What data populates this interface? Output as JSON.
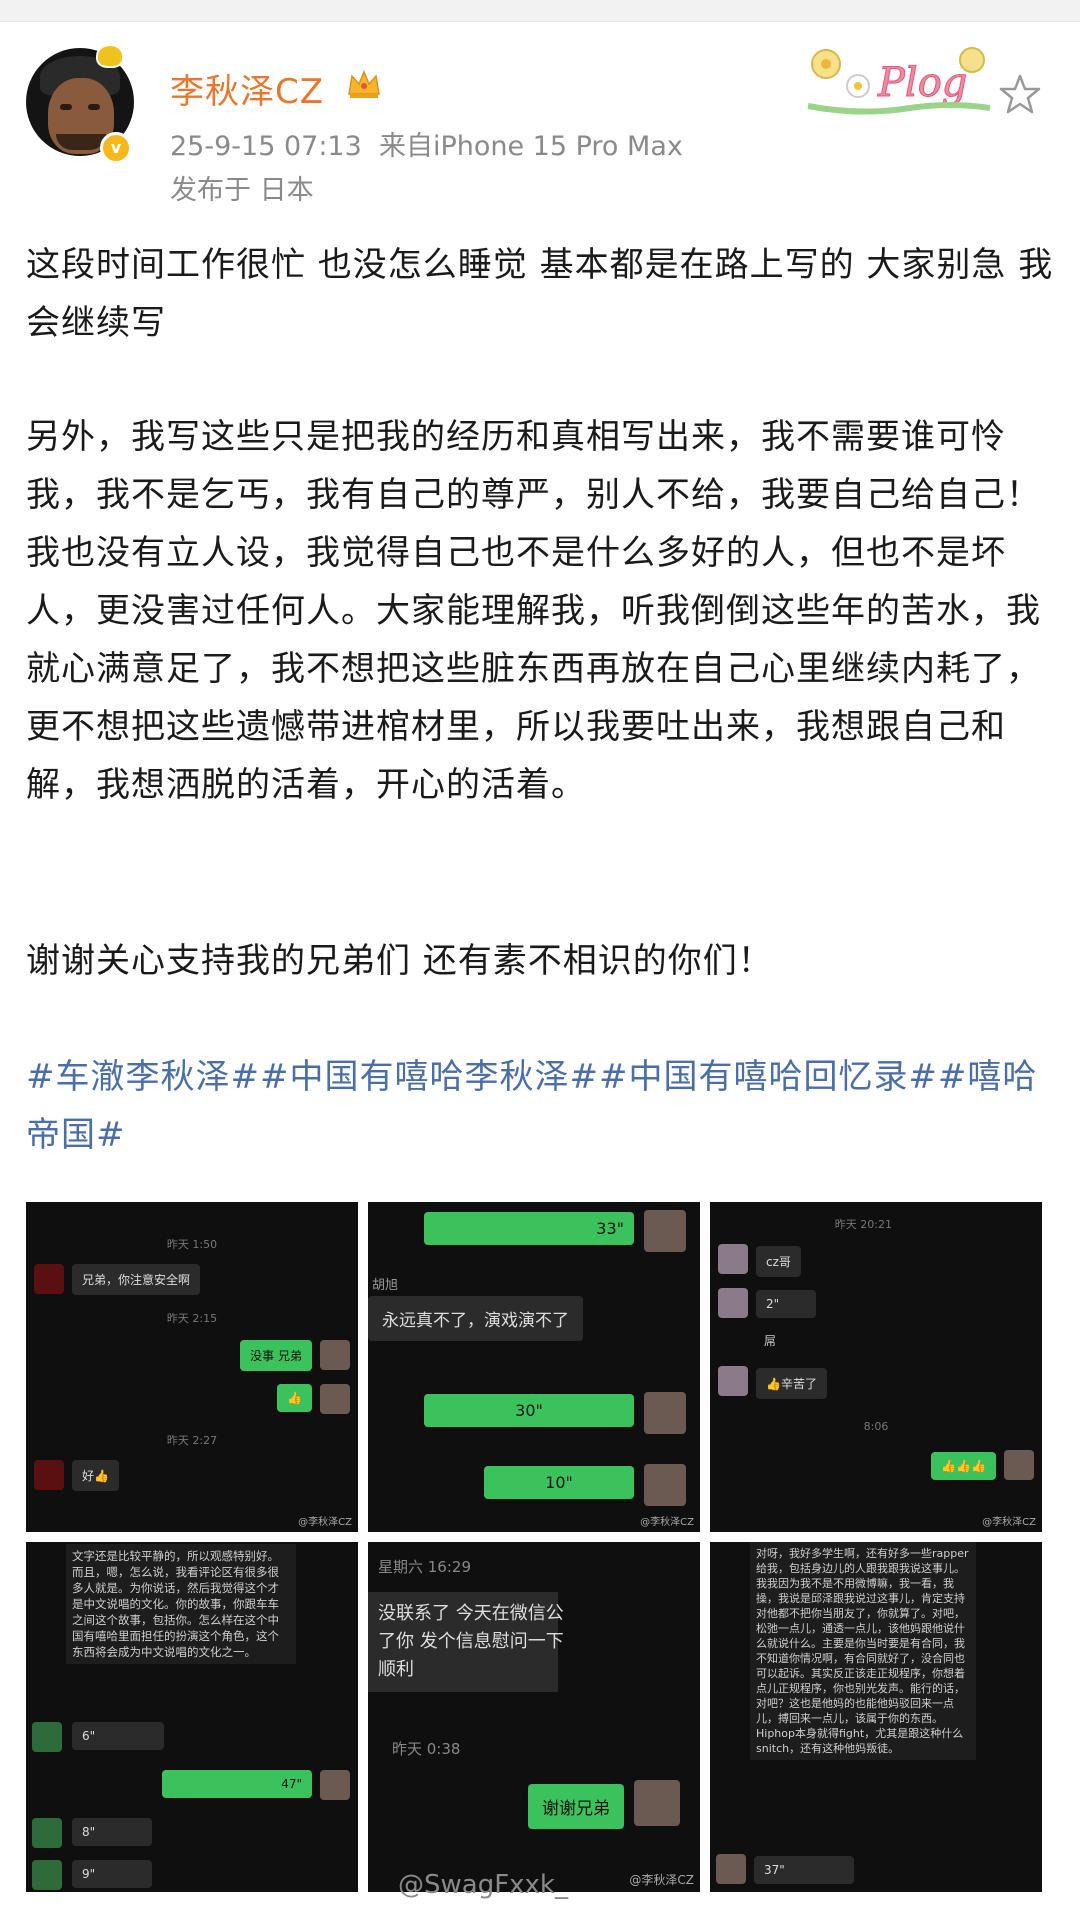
{
  "header": {
    "username": "李秋泽CZ",
    "timestamp": "25-9-15 07:13",
    "source": "来自iPhone 15 Pro Max",
    "location": "发布于 日本",
    "badge_icon": "verified-badge-icon",
    "sticker_text": "Plog"
  },
  "post": {
    "para1": "这段时间工作很忙 也没怎么睡觉 基本都是在路上写的 大家别急 我会继续写",
    "para2": "另外，我写这些只是把我的经历和真相写出来，我不需要谁可怜我，我不是乞丐，我有自己的尊严，别人不给，我要自己给自己！我也没有立人设，我觉得自己也不是什么多好的人，但也不是坏人，更没害过任何人。大家能理解我，听我倒倒这些年的苦水，我就心满意足了，我不想把这些脏东西再放在自己心里继续内耗了，更不想把这些遗憾带进棺材里，所以我要吐出来，我想跟自己和解，我想洒脱的活着，开心的活着。",
    "para3": "谢谢关心支持我的兄弟们 还有素不相识的你们！",
    "tags": "#车澈李秋泽##中国有嘻哈李秋泽##中国有嘻哈回忆录##嘻哈帝国#"
  },
  "images": {
    "img1": {
      "time1": "昨天 1:50",
      "msg1": "兄弟，你注意安全啊",
      "time2": "昨天 2:15",
      "msg2": "没事 兄弟",
      "msg3": "👍",
      "time3": "昨天 2:27",
      "msg4": "好👍",
      "watermark": "@李秋泽CZ"
    },
    "img2": {
      "voice1": "33\"",
      "name": "胡旭",
      "msg1": "永远真不了，演戏演不了",
      "voice2": "30\"",
      "voice3": "10\"",
      "watermark": "@李秋泽CZ"
    },
    "img3": {
      "time1": "昨天 20:21",
      "msg1": "cz哥",
      "voice1": "2\"",
      "msg2": "屌",
      "msg3": "👍辛苦了",
      "time2": "8:06",
      "msg4": "👍👍👍",
      "watermark": "@李秋泽CZ"
    },
    "img4": {
      "text": "文字还是比较平静的，所以观感特别好。而且，嗯，怎么说，我看评论区有很多很多人就是。为你说话，然后我觉得这个才是中文说唱的文化。你的故事，你跟车车之间这个故事，包括你。怎么样在这个中国有嘻哈里面担任的扮演这个角色，这个东西将会成为中文说唱的文化之一。",
      "voice1": "6\"",
      "voice2": "47\"",
      "voice3": "8\"",
      "voice4": "9\""
    },
    "img5": {
      "time1": "星期六 16:29",
      "msg1": "没联系了 今天在微信公\n了你 发个信息慰问一下\n顺利",
      "time2": "昨天 0:38",
      "msg2": "谢谢兄弟",
      "watermark": "@李秋泽CZ"
    },
    "img6": {
      "text": "对呀，我好多学生啊，还有好多一些rapper给我，包括身边儿的人跟我跟我说这事儿。我我因为我不是不用微博嘛，我一看，我操，我说是邱泽跟我说过这事儿，肯定支持对他都不把你当朋友了，你就算了。对吧，松弛一点儿，通透一点儿，该他妈跟他说什么就说什么。主要是你当时要是有合同，我不知道你情况啊，有合同就好了，没合同也可以起诉。其实反正该走正规程序，你想着点儿正规程序，你也别光发声。能行的话，对吧？这也是他妈的也能他妈驳回来一点儿，搏回来一点儿，该属于你的东西。Hiphop本身就得fight，尤其是跟这种什么snitch，还有这种他妈叛徒。",
      "voice1": "37\""
    }
  },
  "footer": {
    "watermark": "@SwagFxxk_"
  }
}
